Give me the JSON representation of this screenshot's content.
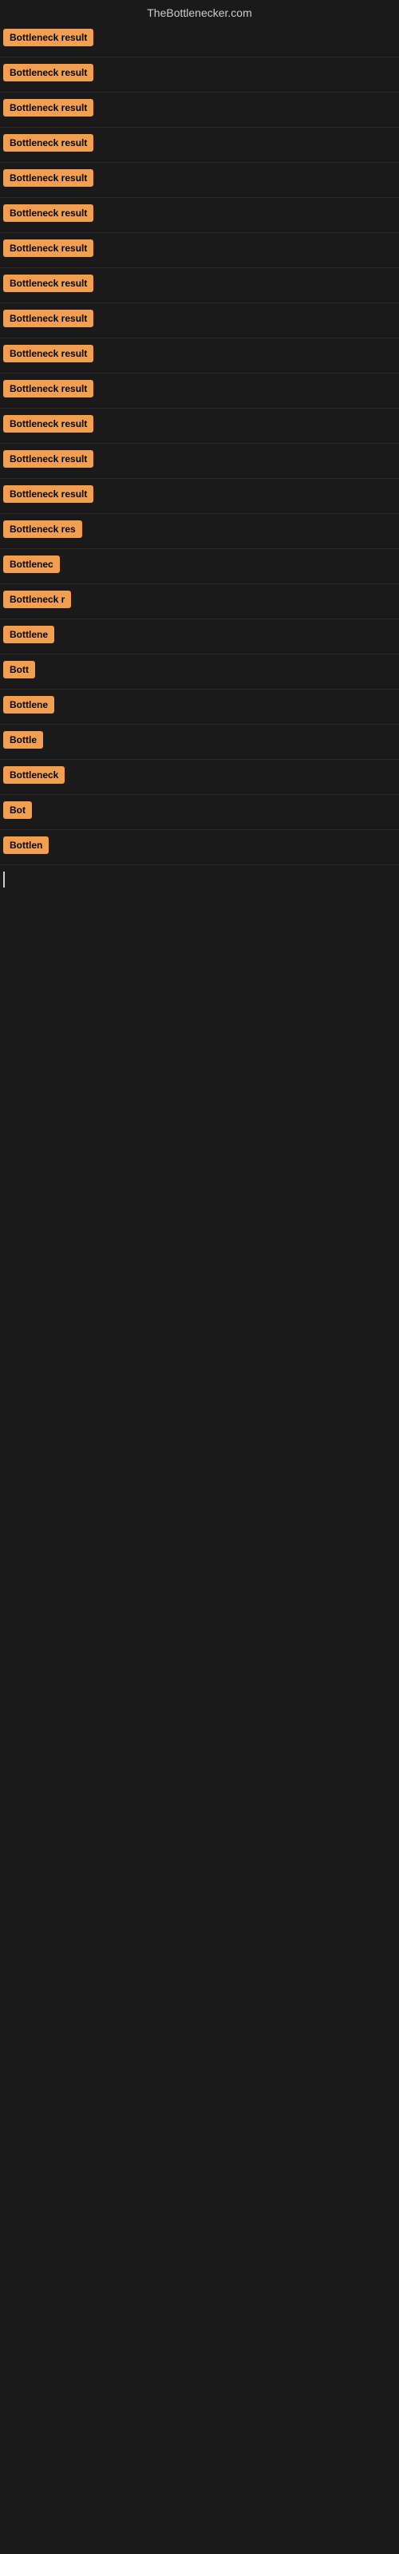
{
  "site": {
    "title": "TheBottlenecker.com"
  },
  "results": [
    {
      "id": 1,
      "label": "Bottleneck result",
      "width": 130
    },
    {
      "id": 2,
      "label": "Bottleneck result",
      "width": 130
    },
    {
      "id": 3,
      "label": "Bottleneck result",
      "width": 130
    },
    {
      "id": 4,
      "label": "Bottleneck result",
      "width": 130
    },
    {
      "id": 5,
      "label": "Bottleneck result",
      "width": 130
    },
    {
      "id": 6,
      "label": "Bottleneck result",
      "width": 130
    },
    {
      "id": 7,
      "label": "Bottleneck result",
      "width": 130
    },
    {
      "id": 8,
      "label": "Bottleneck result",
      "width": 130
    },
    {
      "id": 9,
      "label": "Bottleneck result",
      "width": 130
    },
    {
      "id": 10,
      "label": "Bottleneck result",
      "width": 130
    },
    {
      "id": 11,
      "label": "Bottleneck result",
      "width": 130
    },
    {
      "id": 12,
      "label": "Bottleneck result",
      "width": 130
    },
    {
      "id": 13,
      "label": "Bottleneck result",
      "width": 130
    },
    {
      "id": 14,
      "label": "Bottleneck result",
      "width": 130
    },
    {
      "id": 15,
      "label": "Bottleneck res",
      "width": 110
    },
    {
      "id": 16,
      "label": "Bottlenec",
      "width": 75
    },
    {
      "id": 17,
      "label": "Bottleneck r",
      "width": 88
    },
    {
      "id": 18,
      "label": "Bottlene",
      "width": 68
    },
    {
      "id": 19,
      "label": "Bott",
      "width": 42
    },
    {
      "id": 20,
      "label": "Bottlene",
      "width": 68
    },
    {
      "id": 21,
      "label": "Bottle",
      "width": 52
    },
    {
      "id": 22,
      "label": "Bottleneck",
      "width": 80
    },
    {
      "id": 23,
      "label": "Bot",
      "width": 36
    },
    {
      "id": 24,
      "label": "Bottlen",
      "width": 60
    }
  ]
}
